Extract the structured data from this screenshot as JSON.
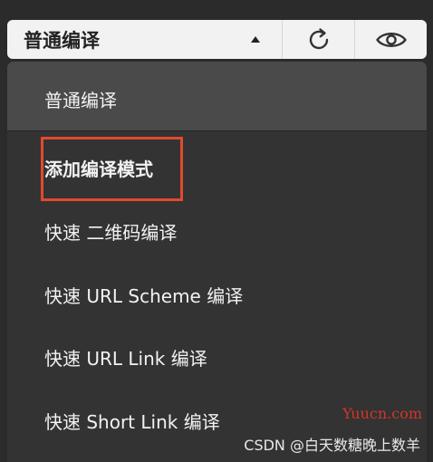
{
  "toolbar": {
    "compile_mode_label": "普通编译",
    "refresh_icon": "refresh-icon",
    "preview_icon": "eye-icon"
  },
  "menu": {
    "items": [
      {
        "label": "普通编译"
      },
      {
        "label": "添加编译模式"
      },
      {
        "label": "快速 二维码编译"
      },
      {
        "label": "快速 URL Scheme 编译"
      },
      {
        "label": "快速 URL Link 编译"
      },
      {
        "label": "快速 Short Link 编译"
      }
    ]
  },
  "watermarks": {
    "site": "Yuucn.com",
    "csdn": "CSDN @白天数糖晚上数羊"
  },
  "colors": {
    "toolbar_bg": "#f2f2f2",
    "menu_bg": "#333333",
    "menu_selected_bg": "#4a4a4a",
    "highlight_border": "#e04a2f",
    "site_watermark": "#d4342a"
  }
}
